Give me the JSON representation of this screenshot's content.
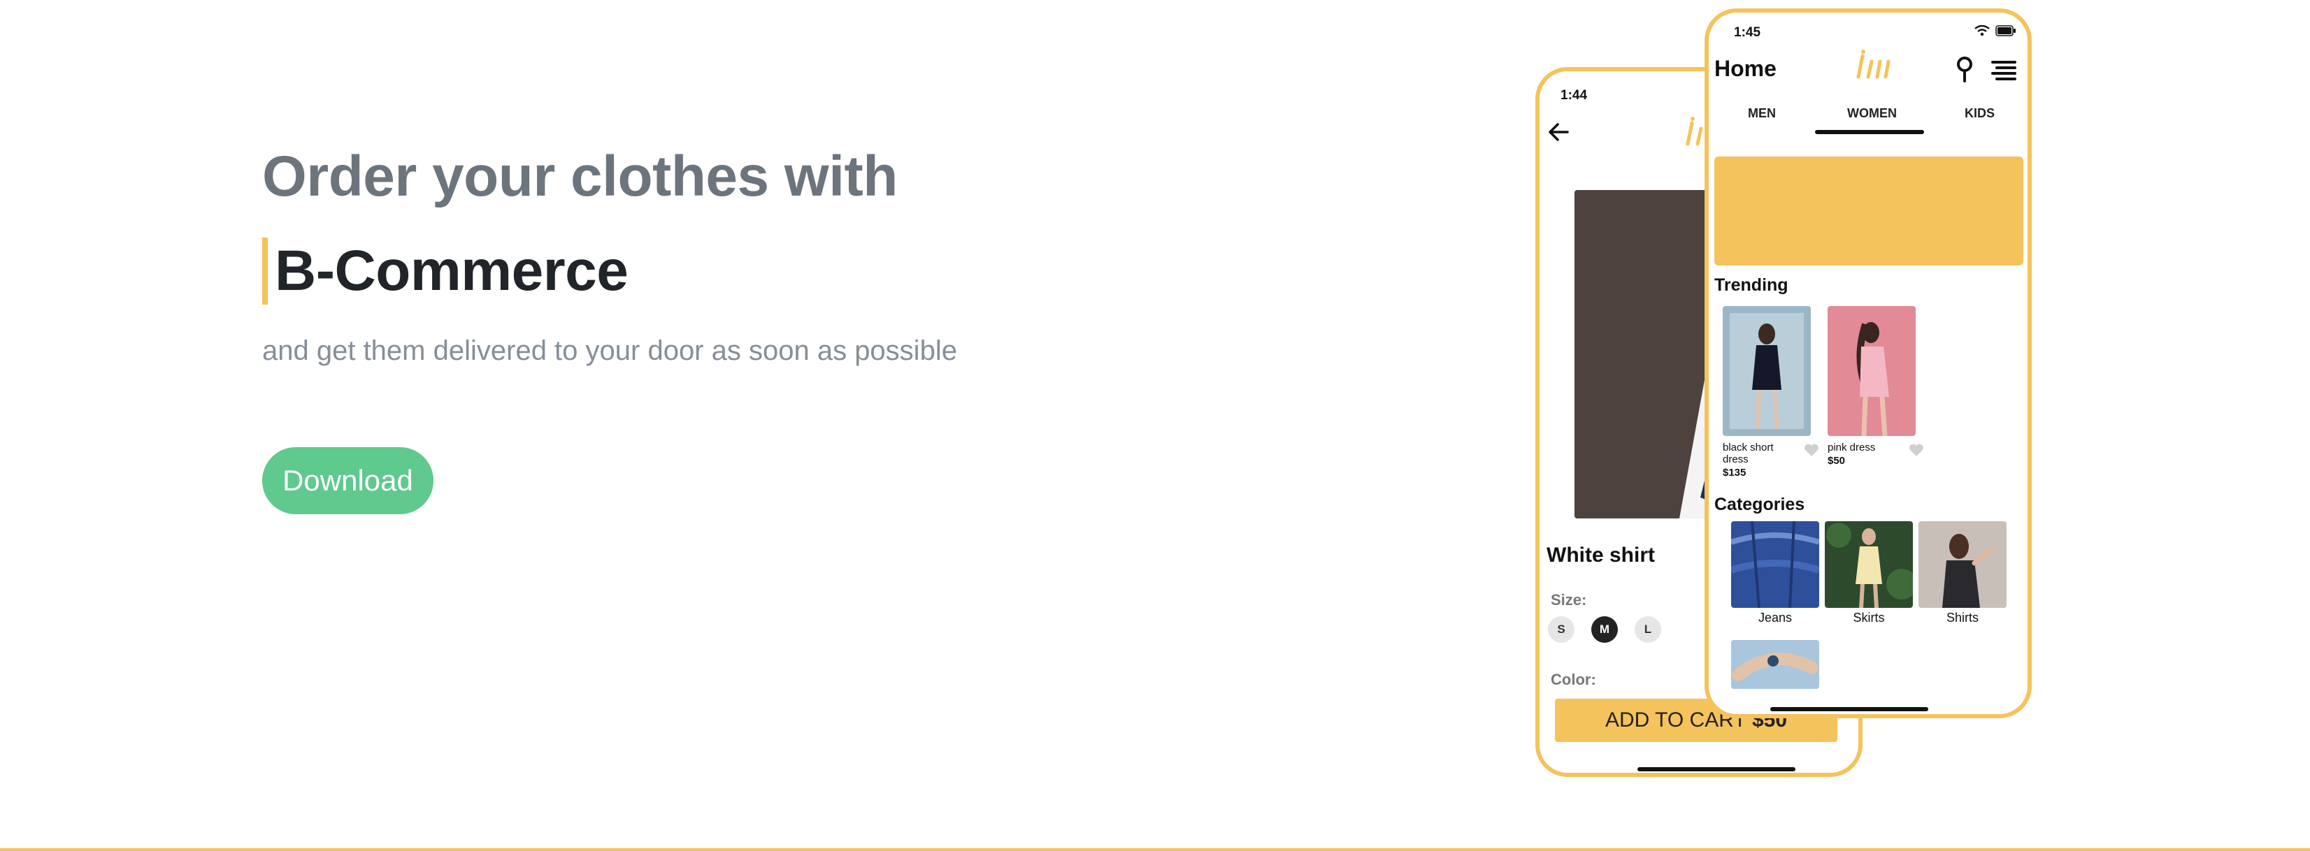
{
  "hero": {
    "headline": "Order your clothes with",
    "brand": "B-Commerce",
    "tagline": "and get them delivered to your door as soon as possible",
    "download_label": "Download"
  },
  "colors": {
    "accent": "#f5c35c",
    "download": "#5fc98e",
    "headline": "#6c757d",
    "brand": "#212529"
  },
  "product_screen": {
    "time": "1:44",
    "product_title": "White shirt",
    "size_label": "Size:",
    "sizes": [
      "S",
      "M",
      "L"
    ],
    "selected_size": "M",
    "color_label": "Color:",
    "add_to_cart_label": "ADD TO CART",
    "price": "$50"
  },
  "home_screen": {
    "time": "1:45",
    "title": "Home",
    "tabs": [
      "MEN",
      "WOMEN",
      "KIDS"
    ],
    "active_tab": "WOMEN",
    "trending_title": "Trending",
    "trending": [
      {
        "name": "black short dress",
        "price": "$135"
      },
      {
        "name": "pink dress",
        "price": "$50"
      }
    ],
    "categories_title": "Categories",
    "categories": [
      "Jeans",
      "Skirts",
      "Shirts"
    ]
  },
  "icons": [
    "back-arrow-icon",
    "logo-icon",
    "location-pin-icon",
    "menu-icon",
    "wifi-icon",
    "battery-icon",
    "heart-icon"
  ]
}
